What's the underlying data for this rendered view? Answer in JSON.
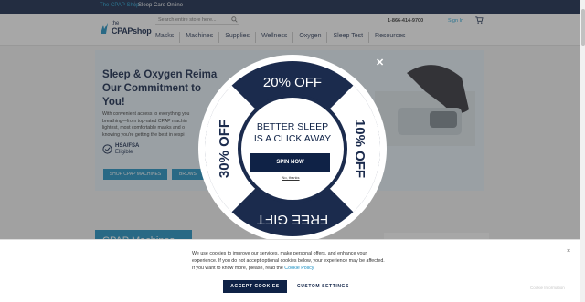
{
  "topbar": {
    "link_shop": "The CPAP Shop",
    "separator": "|",
    "link_sleep_care": "Sleep Care Online"
  },
  "header": {
    "logo_the": "the",
    "logo_name": "CPAPshop",
    "search_placeholder": "Search entire store here...",
    "phone": "1-866-414-9700",
    "signin": "Sign In",
    "nav": [
      "Masks",
      "Machines",
      "Supplies",
      "Wellness",
      "Oxygen",
      "Sleep Test",
      "Resources"
    ]
  },
  "hero": {
    "title_lines": [
      "Sleep & Oxygen Reima",
      "Our Commitment to",
      "You!"
    ],
    "body_lines": [
      "With convenient access to everything you",
      "breathing—from top-rated CPAP machin",
      "lightest, most comfortable masks and o",
      "knowing you're getting the best in respi"
    ],
    "hsa_line1": "HSA/FSA",
    "hsa_line2": "Eligible",
    "btn_shop": "SHOP CPAP MACHINES",
    "btn_browse": "BROWS"
  },
  "section": {
    "machines_title": "CPAP Machines"
  },
  "popup": {
    "close": "✕",
    "top_label": "20% OFF",
    "right_label": "10% OFF",
    "bottom_label": "FREE GIFT",
    "left_label": "30% OFF",
    "headline_line1": "BETTER SLEEP",
    "headline_line2": "IS A CLICK AWAY",
    "spin_button": "SPIN NOW",
    "no_thanks": "No, thanks",
    "colors": {
      "navy": "#1b2b4d",
      "white": "#ffffff"
    }
  },
  "cookie": {
    "line1": "We use cookies to improve our services, make personal offers, and enhance your",
    "line2": "experience. If you do not accept optional cookies below, your experience may be affected.",
    "line3_prefix": "If you want to know more, please, read the ",
    "policy_link": "Cookie Policy",
    "accept_button": "ACCEPT COOKIES",
    "custom_button": "CUSTOM SETTINGS",
    "close": "×",
    "watermark": "Cookie Information"
  }
}
